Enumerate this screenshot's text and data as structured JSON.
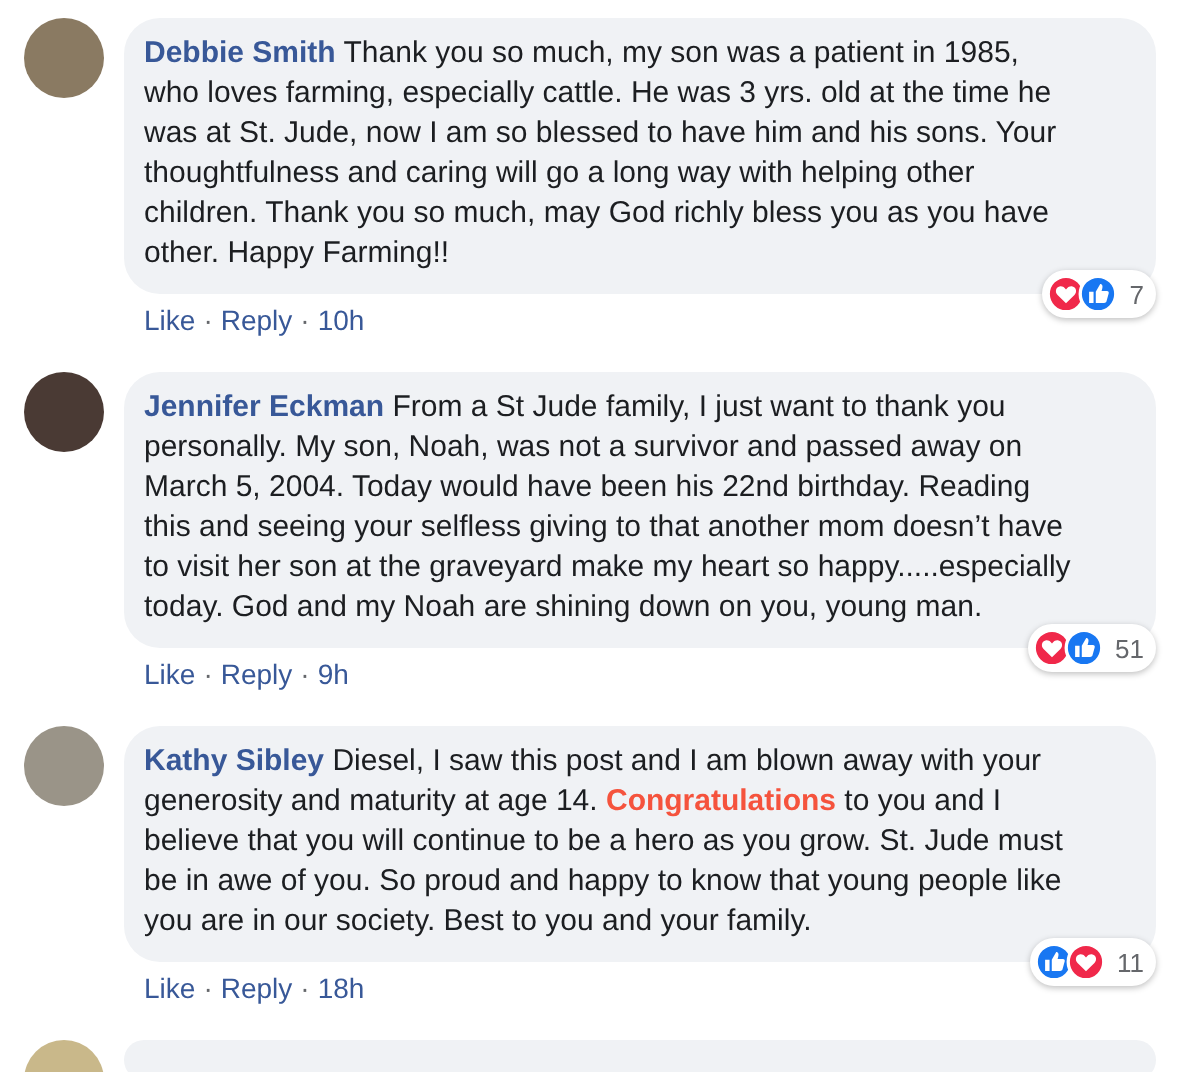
{
  "comments": [
    {
      "author": "Debbie Smith",
      "body": [
        {
          "kind": "plain",
          "text": "Thank you so much, my son was a patient in 1985, who loves farming, especially cattle. He was 3 yrs. old at the time he was at St. Jude, now I am so blessed to have him and his sons. Your thoughtfulness and caring will go a long way with helping other children. Thank you so much, may God richly bless you as you have other. Happy Farming!!"
        }
      ],
      "reactions": [
        {
          "kind": "love"
        },
        {
          "kind": "like"
        }
      ],
      "reaction_count": "7",
      "footer": [
        {
          "kind": "link",
          "text": "Like"
        },
        {
          "kind": "dot",
          "text": "·"
        },
        {
          "kind": "link",
          "text": "Reply"
        },
        {
          "kind": "dot",
          "text": "·"
        },
        {
          "kind": "time",
          "text": "10h"
        }
      ]
    },
    {
      "author": "Jennifer Eckman",
      "body": [
        {
          "kind": "plain",
          "text": "From a St Jude family, I just want to thank you personally. My son, Noah, was not a survivor and passed away on March 5, 2004. Today would have been his 22nd birthday. Reading this and seeing your selfless giving to that another mom doesn’t have to visit her son at the graveyard make my heart so happy.....especially today. God and my Noah are shining down on you, young man."
        }
      ],
      "reactions": [
        {
          "kind": "love"
        },
        {
          "kind": "like"
        }
      ],
      "reaction_count": "51",
      "footer": [
        {
          "kind": "link",
          "text": "Like"
        },
        {
          "kind": "dot",
          "text": "·"
        },
        {
          "kind": "link",
          "text": "Reply"
        },
        {
          "kind": "dot",
          "text": "·"
        },
        {
          "kind": "time",
          "text": "9h"
        }
      ]
    },
    {
      "author": "Kathy Sibley",
      "body": [
        {
          "kind": "plain",
          "text": "Diesel, I saw this post and I am blown away with your generosity and maturity at age 14. "
        },
        {
          "kind": "highlight",
          "text": "Congratulations"
        },
        {
          "kind": "plain",
          "text": " to you and I believe that you will continue to be a hero as you grow. St. Jude must be in awe of you. So proud and happy to know that young people like you are in our society. Best to you and your family."
        }
      ],
      "reactions": [
        {
          "kind": "like"
        },
        {
          "kind": "love"
        }
      ],
      "reaction_count": "11",
      "footer": [
        {
          "kind": "link",
          "text": "Like"
        },
        {
          "kind": "dot",
          "text": "·"
        },
        {
          "kind": "link",
          "text": "Reply"
        },
        {
          "kind": "dot",
          "text": "·"
        },
        {
          "kind": "time",
          "text": "18h"
        }
      ]
    }
  ],
  "more_below": true
}
